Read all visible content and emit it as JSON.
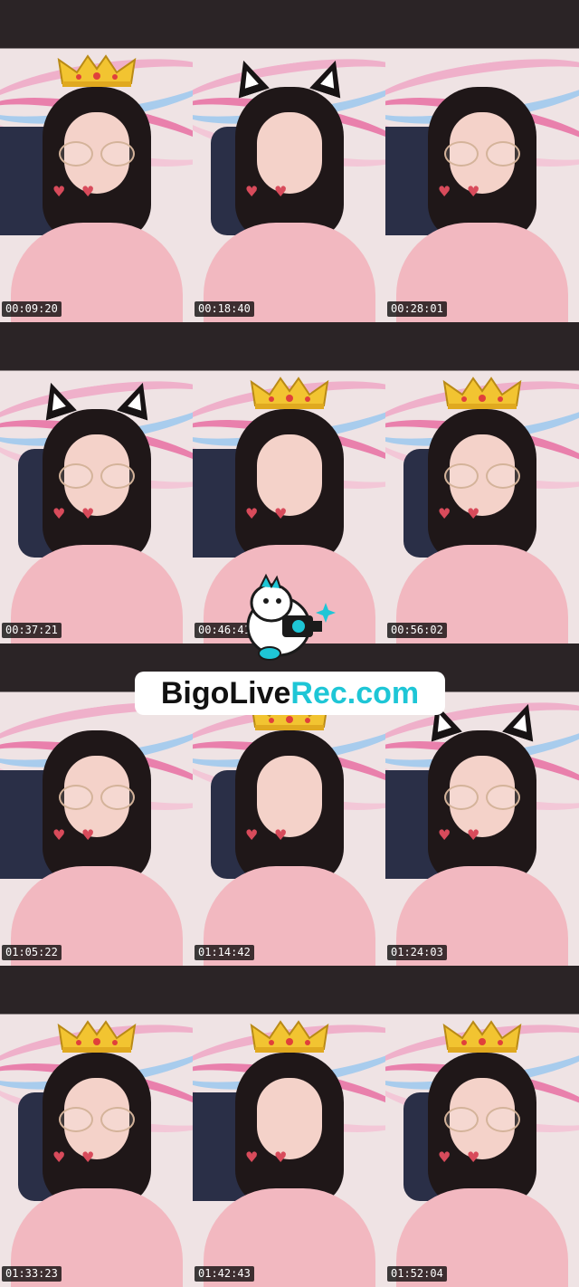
{
  "watermark": {
    "text_dark": "BigoLive",
    "text_accent": "Rec.com",
    "accent_color": "#1ec6d6"
  },
  "mascot": {
    "icon": "bigo-mascot-icon"
  },
  "tiles": [
    {
      "time": "00:09:20",
      "overlay": "crown"
    },
    {
      "time": "00:18:40",
      "overlay": "cat-ears"
    },
    {
      "time": "00:28:01",
      "overlay": "none"
    },
    {
      "time": "00:37:21",
      "overlay": "cat-ears"
    },
    {
      "time": "00:46:41",
      "overlay": "crown"
    },
    {
      "time": "00:56:02",
      "overlay": "crown"
    },
    {
      "time": "01:05:22",
      "overlay": "none"
    },
    {
      "time": "01:14:42",
      "overlay": "crown"
    },
    {
      "time": "01:24:03",
      "overlay": "cat-ears"
    },
    {
      "time": "01:33:23",
      "overlay": "crown"
    },
    {
      "time": "01:42:43",
      "overlay": "crown"
    },
    {
      "time": "01:52:04",
      "overlay": "crown"
    }
  ]
}
